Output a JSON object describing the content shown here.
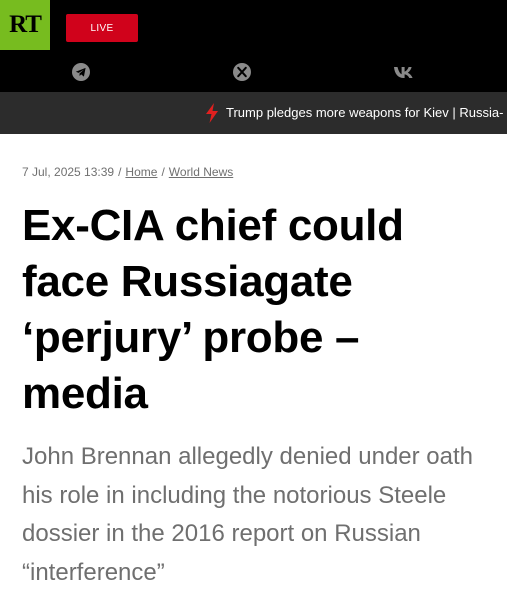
{
  "header": {
    "logo_text": "RT",
    "live_label": "LIVE",
    "social_icons": [
      "telegram-icon",
      "x-icon",
      "vk-icon"
    ],
    "colors": {
      "brand_green": "#77bc1f",
      "live_red": "#d0021b",
      "ticker_bg": "#2c2c2c"
    }
  },
  "ticker": {
    "icon": "lightning-icon",
    "text": "Trump pledges more weapons for Kiev | Russia-"
  },
  "article": {
    "date": "7 Jul, 2025 13:39",
    "separator": "/",
    "breadcrumb": [
      "Home",
      "World News"
    ],
    "title": "Ex-CIA chief could face Russiagate ‘perjury’ probe – media",
    "summary": "John Brennan allegedly denied under oath his role in including the notorious Steele dossier in the 2016 report on Russian “interference”"
  }
}
